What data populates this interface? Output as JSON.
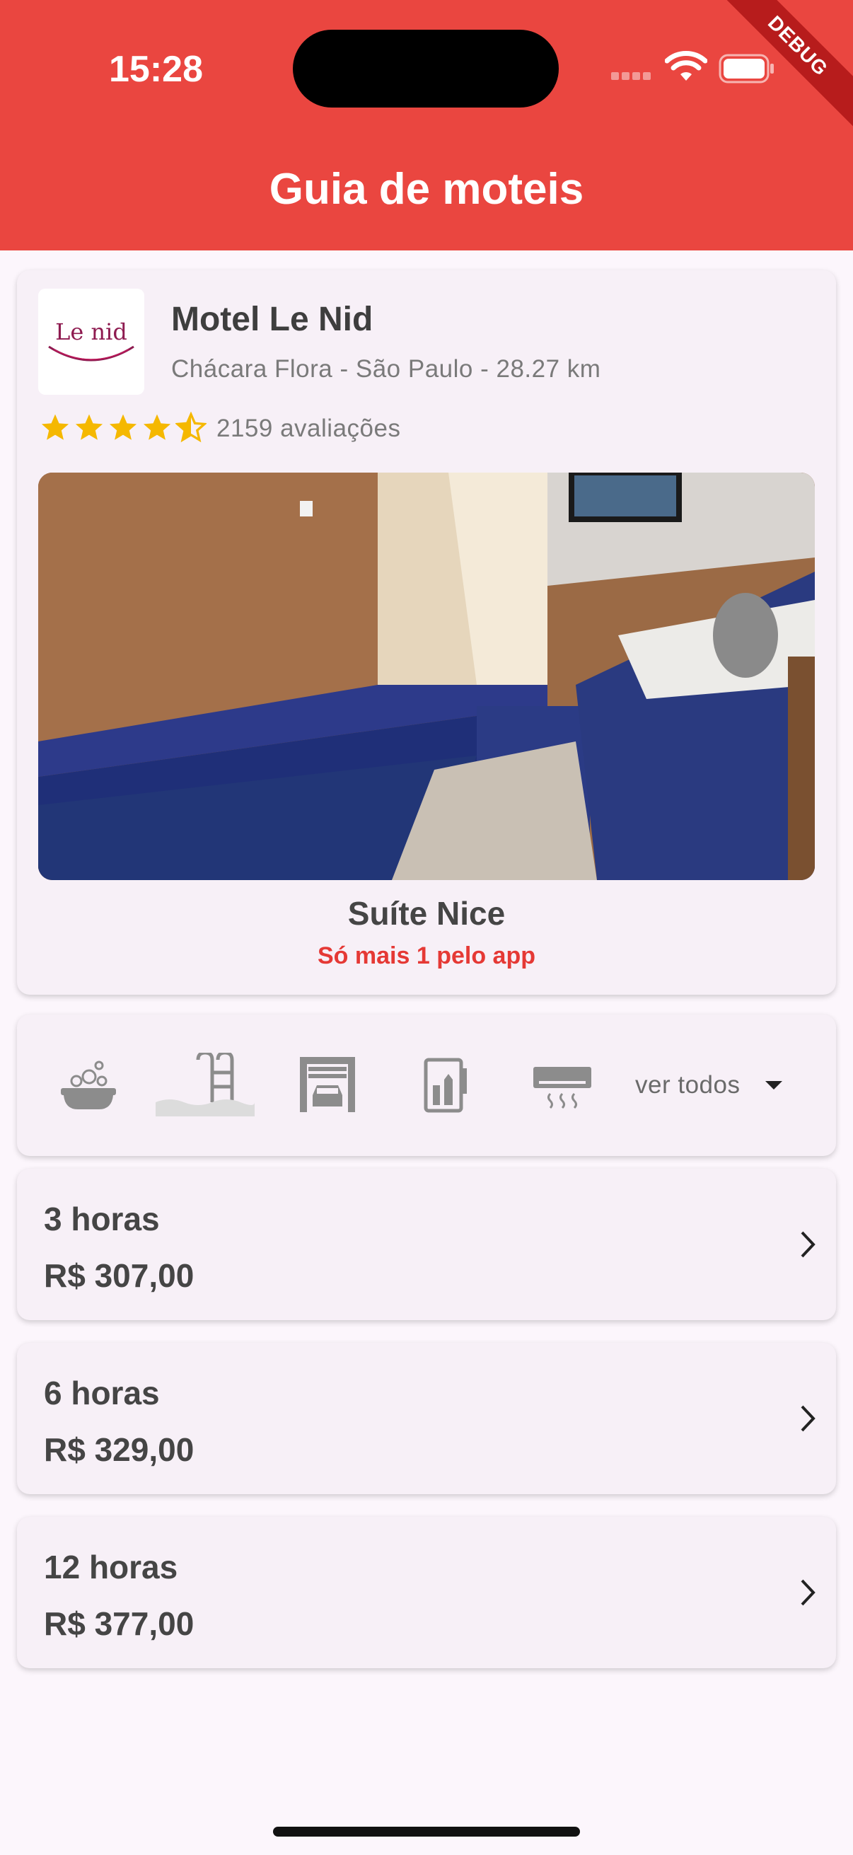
{
  "status_bar": {
    "time": "15:28",
    "debug_label": "DEBUG"
  },
  "app_bar": {
    "title": "Guia de moteis"
  },
  "motel": {
    "logo_text": "Le nid",
    "name": "Motel Le Nid",
    "location": "Chácara Flora - São Paulo - 28.27 km",
    "rating": 4.5,
    "reviews": "2159 avaliações",
    "star_color": "#f5b800"
  },
  "suite": {
    "name": "Suíte Nice",
    "promo": "Só mais 1 pelo app"
  },
  "amenities": {
    "icons": [
      "bathtub-icon",
      "pool-icon",
      "garage-icon",
      "minibar-icon",
      "air-conditioning-icon"
    ],
    "see_all": "ver todos"
  },
  "prices": [
    {
      "duration": "3 horas",
      "price": "R$ 307,00"
    },
    {
      "duration": "6 horas",
      "price": "R$ 329,00"
    },
    {
      "duration": "12 horas",
      "price": "R$ 377,00"
    }
  ],
  "colors": {
    "primary": "#ea4640",
    "promo": "#e53935",
    "background": "#fcf6fc"
  }
}
